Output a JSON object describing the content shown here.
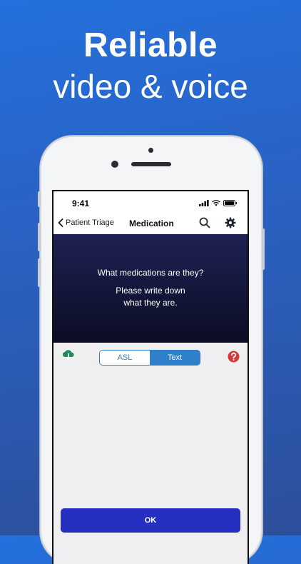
{
  "headline": {
    "line1": "Reliable",
    "line2": "video & voice"
  },
  "status_bar": {
    "time": "9:41"
  },
  "nav": {
    "back_label": "Patient Triage",
    "title": "Medication",
    "search_icon": "search-icon",
    "settings_icon": "gear-icon"
  },
  "prompt": {
    "question": "What medications are they?",
    "instruction_line1": "Please write down",
    "instruction_line2": "what they are."
  },
  "toolbar": {
    "cloud_icon": "cloud-download-icon",
    "segments": [
      {
        "label": "ASL",
        "selected": false
      },
      {
        "label": "Text",
        "selected": true
      }
    ],
    "help_icon": "help-icon"
  },
  "ok_label": "OK",
  "colors": {
    "background": "#2a60c0",
    "accent": "#2f7fca",
    "ok_button": "#2530c2",
    "help": "#d23a3a",
    "cloud": "#1f8a5a",
    "prompt_bg": "#14163a"
  }
}
